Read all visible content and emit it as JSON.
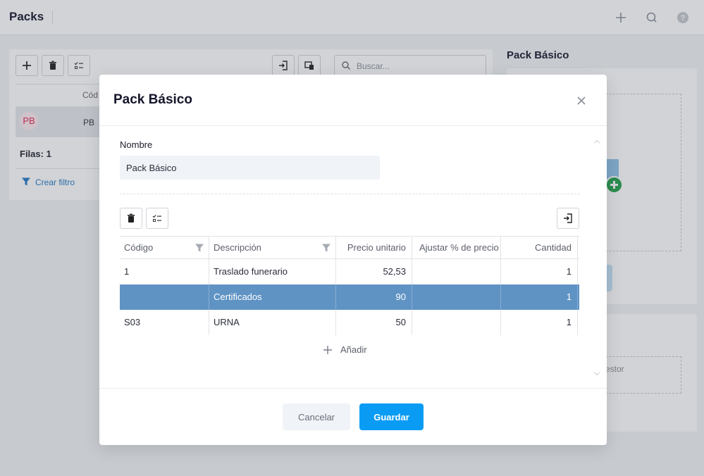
{
  "app": {
    "page_title": "Packs",
    "icons": [
      "plus-icon",
      "search-icon",
      "help-icon"
    ]
  },
  "background_list": {
    "search_placeholder": "Buscar...",
    "column_header": "Cód",
    "row": {
      "avatar_initials": "PB",
      "code": "PB"
    },
    "rows_count_label": "Filas: 1",
    "create_filter_label": "Crear filtro"
  },
  "right_panel": {
    "title": "Pack Básico",
    "placeholder_fragment": "estor"
  },
  "modal": {
    "title": "Pack Básico",
    "name_label": "Nombre",
    "name_value": "Pack Básico",
    "grid": {
      "columns": [
        {
          "label": "Código",
          "filterable": true
        },
        {
          "label": "Descripción",
          "filterable": true
        },
        {
          "label": "Precio unitario",
          "filterable": false
        },
        {
          "label": "Ajustar % de precio",
          "filterable": false
        },
        {
          "label": "Cantidad",
          "filterable": false
        }
      ],
      "rows": [
        {
          "codigo": "1",
          "descripcion": "Traslado funerario",
          "precio": "52,53",
          "ajuste": "",
          "cantidad": "1",
          "selected": false
        },
        {
          "codigo": "",
          "descripcion": "Certificados",
          "precio": "90",
          "ajuste": "",
          "cantidad": "1",
          "selected": true
        },
        {
          "codigo": "S03",
          "descripcion": "URNA",
          "precio": "50",
          "ajuste": "",
          "cantidad": "1",
          "selected": false
        }
      ]
    },
    "add_label": "Añadir",
    "cancel_label": "Cancelar",
    "save_label": "Guardar"
  },
  "colors": {
    "primary": "#0a9cf5",
    "selected_row": "#5f93c4",
    "avatar_text": "#e02a55",
    "link": "#2377c8"
  }
}
